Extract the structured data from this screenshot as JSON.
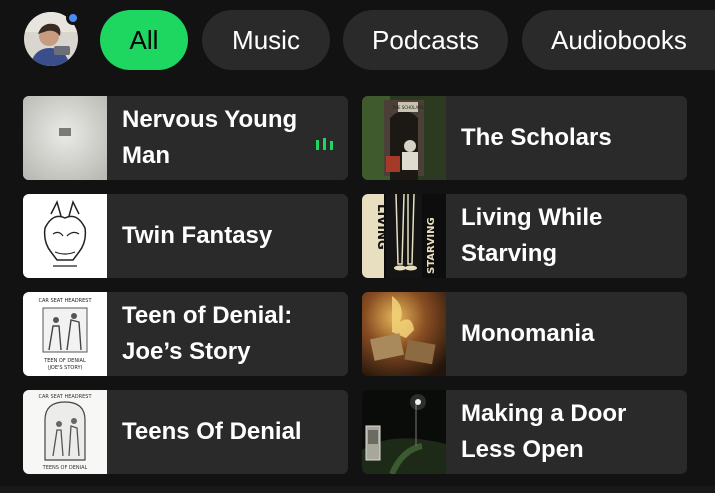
{
  "filters": {
    "all": "All",
    "music": "Music",
    "podcasts": "Podcasts",
    "audiobooks": "Audiobooks"
  },
  "colors": {
    "accent": "#1ed760",
    "card_bg": "#2a2a2a",
    "page_bg": "#121212",
    "notification_dot": "#4a8cf7"
  },
  "shortcuts": [
    {
      "title": "Nervous Young Man",
      "playing": true,
      "cover_icon": "nervous-young-man-cover"
    },
    {
      "title": "The Scholars",
      "playing": false,
      "cover_icon": "the-scholars-cover"
    },
    {
      "title": "Twin Fantasy",
      "playing": false,
      "cover_icon": "twin-fantasy-cover"
    },
    {
      "title": "Living While Starving",
      "playing": false,
      "cover_icon": "living-while-starving-cover"
    },
    {
      "title": "Teen of Denial: Joe’s Story",
      "playing": false,
      "cover_icon": "teen-of-denial-joes-story-cover"
    },
    {
      "title": "Monomania",
      "playing": false,
      "cover_icon": "monomania-cover"
    },
    {
      "title": "Teens Of Denial",
      "playing": false,
      "cover_icon": "teens-of-denial-cover"
    },
    {
      "title": "Making a Door Less Open",
      "playing": false,
      "cover_icon": "making-a-door-less-open-cover"
    }
  ],
  "cover_text": {
    "scholars": "THE SCHOLARS",
    "lws_left": "LIVING",
    "lws_right": "STARVING",
    "cshh": "CAR SEAT HEADREST",
    "tod_joe": "TEEN OF DENIAL",
    "tod_joe_sub": "(JOE'S STORY)",
    "tod": "TEENS OF DENIAL"
  }
}
